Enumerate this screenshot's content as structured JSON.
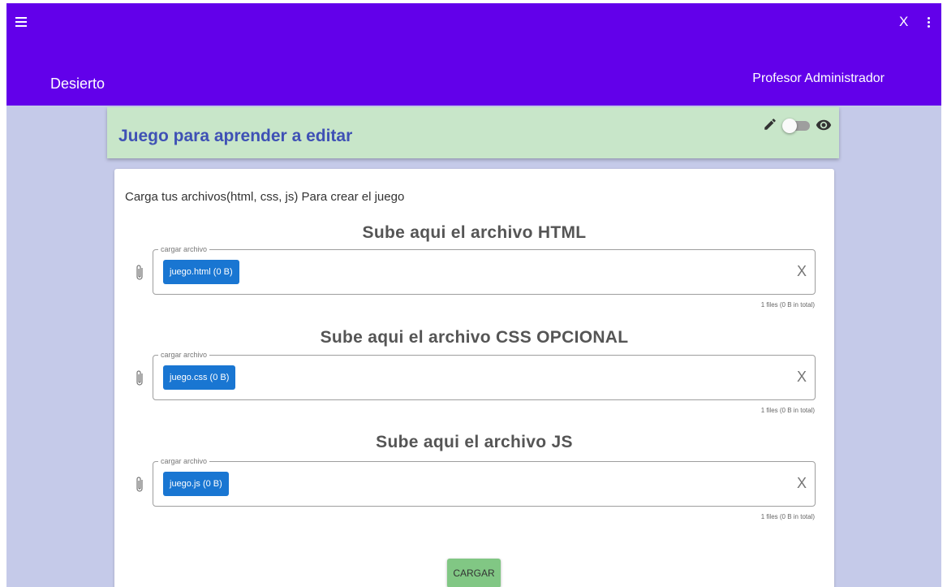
{
  "topbar": {
    "brand": "Desierto",
    "user": "Profesor Administrador",
    "close_label": "X",
    "icons": {
      "menu": "menu-icon",
      "more": "more-vert-icon"
    },
    "color": "#6200ea"
  },
  "game": {
    "title": "Juego para aprender a editar",
    "icons": {
      "edit": "pencil-icon",
      "preview": "eye-icon"
    },
    "edit_mode_toggle_on": false
  },
  "form": {
    "instructions": "Carga tus archivos(html, css, js) Para crear el juego",
    "sections": [
      {
        "title": "Sube aqui el archivo HTML",
        "legend": "cargar archivo",
        "chip": "juego.html (0 B)",
        "clear": "X",
        "count": "1 files (0 B in total)"
      },
      {
        "title": "Sube aqui el archivo CSS OPCIONAL",
        "legend": "cargar archivo",
        "chip": "juego.css (0 B)",
        "clear": "X",
        "count": "1 files (0 B in total)"
      },
      {
        "title": "Sube aqui el archivo JS",
        "legend": "cargar archivo",
        "chip": "juego.js (0 B)",
        "clear": "X",
        "count": "1 files (0 B in total)"
      }
    ],
    "submit_label": "CARGAR"
  },
  "colors": {
    "background": "#c5cae9",
    "header_card": "#c8e6c9",
    "title": "#3f51b5",
    "chip": "#1976d2",
    "submit": "#81c784"
  }
}
